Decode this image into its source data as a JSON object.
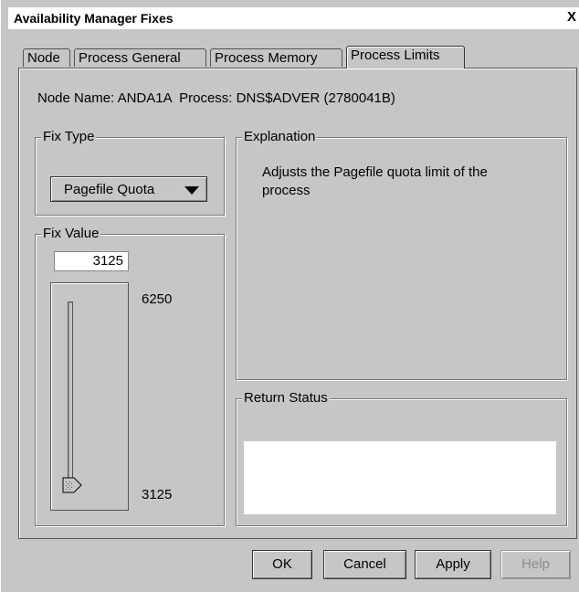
{
  "window": {
    "title": "Availability Manager Fixes",
    "close_label": "X"
  },
  "tabs": [
    {
      "label": "Node",
      "active": false
    },
    {
      "label": "Process General",
      "active": false
    },
    {
      "label": "Process Memory",
      "active": false
    },
    {
      "label": "Process Limits",
      "active": true
    }
  ],
  "info": {
    "node_label": "Node Name:",
    "node_value": "ANDA1A",
    "process_label": "Process:",
    "process_value": "DNS$ADVER (2780041B)"
  },
  "fix_type": {
    "legend": "Fix Type",
    "selected": "Pagefile Quota"
  },
  "fix_value": {
    "legend": "Fix Value",
    "value": "3125",
    "max_label": "6250",
    "min_label": "3125",
    "slider_position": 0
  },
  "explanation": {
    "legend": "Explanation",
    "text": "Adjusts the Pagefile quota limit of the process"
  },
  "return_status": {
    "legend": "Return Status",
    "text": ""
  },
  "buttons": {
    "ok": "OK",
    "cancel": "Cancel",
    "apply": "Apply",
    "help": "Help"
  },
  "colors": {
    "background": "#c6c6c6",
    "field": "#ffffff"
  }
}
